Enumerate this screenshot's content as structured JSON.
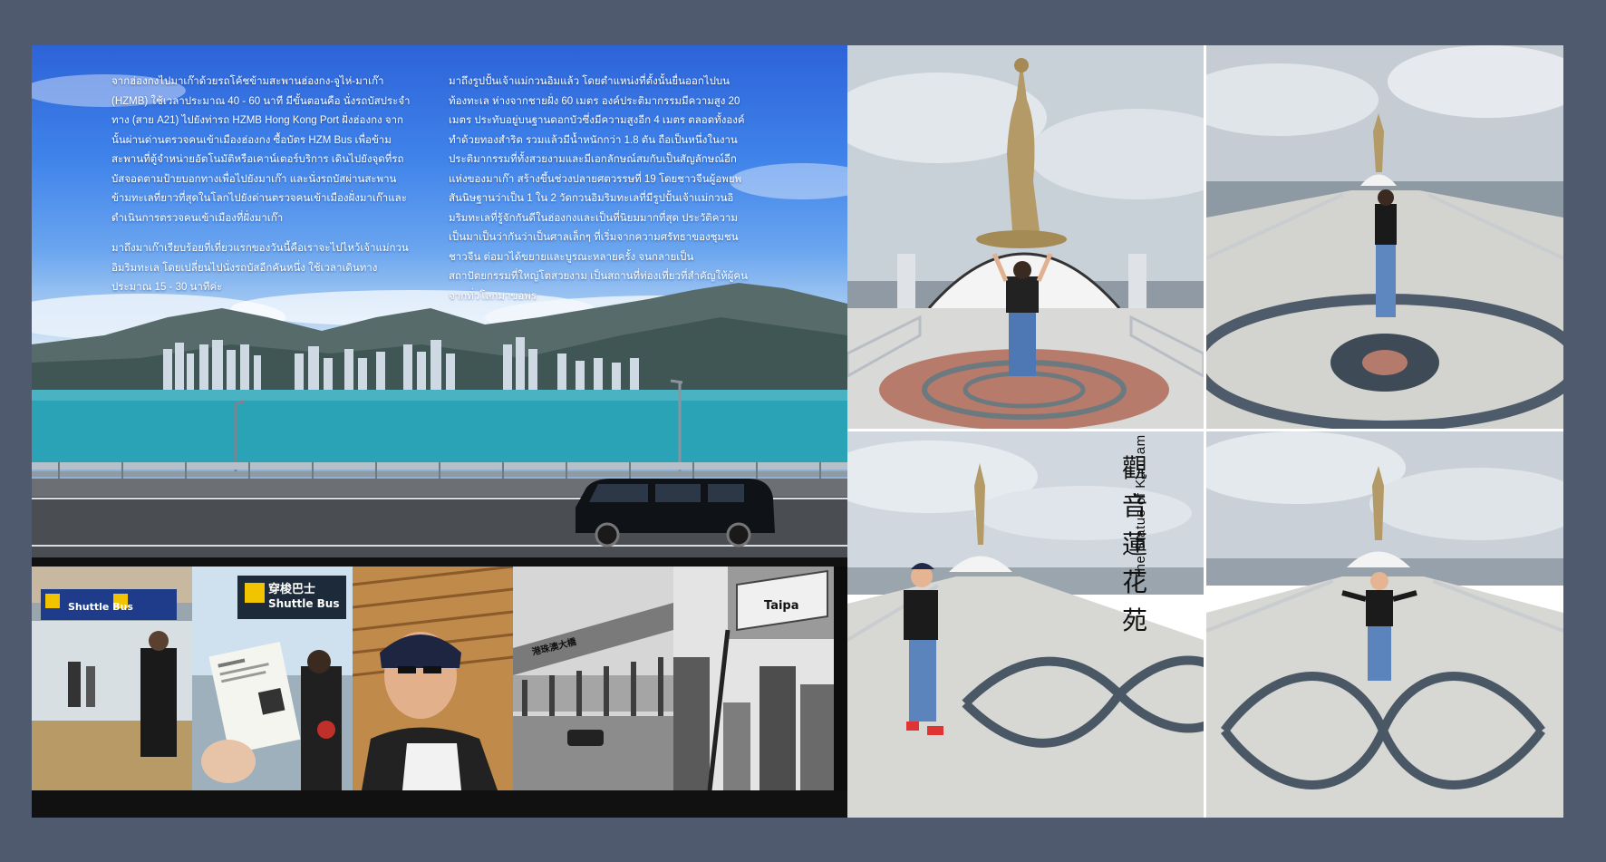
{
  "article": {
    "col1": [
      "จากฮ่องกงไปมาเก๊าด้วยรถโค้ชข้ามสะพานฮ่องกง-จูไห่-มาเก๊า (HZMB) ใช้เวลาประมาณ 40 - 60 นาที มีขั้นตอนคือ นั่งรถบัสประจำทาง (สาย A21) ไปยังท่ารถ HZMB Hong Kong Port ฝั่งฮ่องกง จากนั้นผ่านด่านตรวจคนเข้าเมืองฮ่องกง ซื้อบัตร HZM Bus เพื่อข้ามสะพานที่ตู้จำหน่ายอัตโนมัติหรือเคาน์เตอร์บริการ เดินไปยังจุดที่รถบัสจอดตามป้ายบอกทางเพื่อไปยังมาเก๊า และนั่งรถบัสผ่านสะพานข้ามทะเลที่ยาวที่สุดในโลกไปยังด่านตรวจคนเข้าเมืองฝั่งมาเก๊าและดำเนินการตรวจคนเข้าเมืองที่ฝั่งมาเก๊า",
      "มาถึงมาเก๊าเรียบร้อยที่เที่ยวแรกของวันนี้คือเราจะไปไหว้เจ้าแม่กวนอิมริมทะเล โดยเปลี่ยนไปนั่งรถบัสอีกคันหนึ่ง ใช้เวลาเดินทางประมาณ 15 - 30 นาทีค่ะ"
    ],
    "col2": [
      "มาถึงรูปปั้นเจ้าแม่กวนอิมแล้ว โดยตำแหน่งที่ตั้งนั้นยื่นออกไปบนท้องทะเล ห่างจากชายฝั่ง 60 เมตร องค์ประติมากรรมมีความสูง 20 เมตร ประทับอยู่บนฐานดอกบัวซึ่งมีความสูงอีก 4 เมตร ตลอดทั้งองค์ทำด้วยทองสำริด รวมแล้วมีน้ำหนักกว่า 1.8 ตัน ถือเป็นหนึ่งในงานประติมากรรมที่ทั้งสวยงามและมีเอกลักษณ์สมกับเป็นสัญลักษณ์อีกแห่งของมาเก๊า สร้างขึ้นช่วงปลายศตวรรษที่ 19 โดยชาวจีนผู้อพยพ สันนิษฐานว่าเป็น 1 ใน 2 วัดกวนอิมริมทะเลที่มีรูปปั้นเจ้าแม่กวนอิมริมทะเลที่รู้จักกันดีในฮ่องกงและเป็นที่นิยมมากที่สุด ประวัติความเป็นมาเป็นว่ากันว่าเป็นศาลเล็กๆ ที่เริ่มจากความศรัทธาของชุมชนชาวจีน ต่อมาได้ขยายและบูรณะหลายครั้ง จนกลายเป็นสถาปัตยกรรมที่ใหญ่โตสวยงาม เป็นสถานที่ท่องเที่ยวที่สำคัญให้ผู้คนจากทั่วโลกมาขอพร"
    ]
  },
  "thumbs": {
    "shuttle_sign_cn": "穿梭巴士",
    "shuttle_sign_en": "Shuttle Bus",
    "station_sign": "Shuttle Bus",
    "taipa_sign": "Taipa",
    "bridge_sign": "港珠澳大橋"
  },
  "title": {
    "chinese": "觀音蓮花苑",
    "english": "The Statue of Kun Iam"
  }
}
